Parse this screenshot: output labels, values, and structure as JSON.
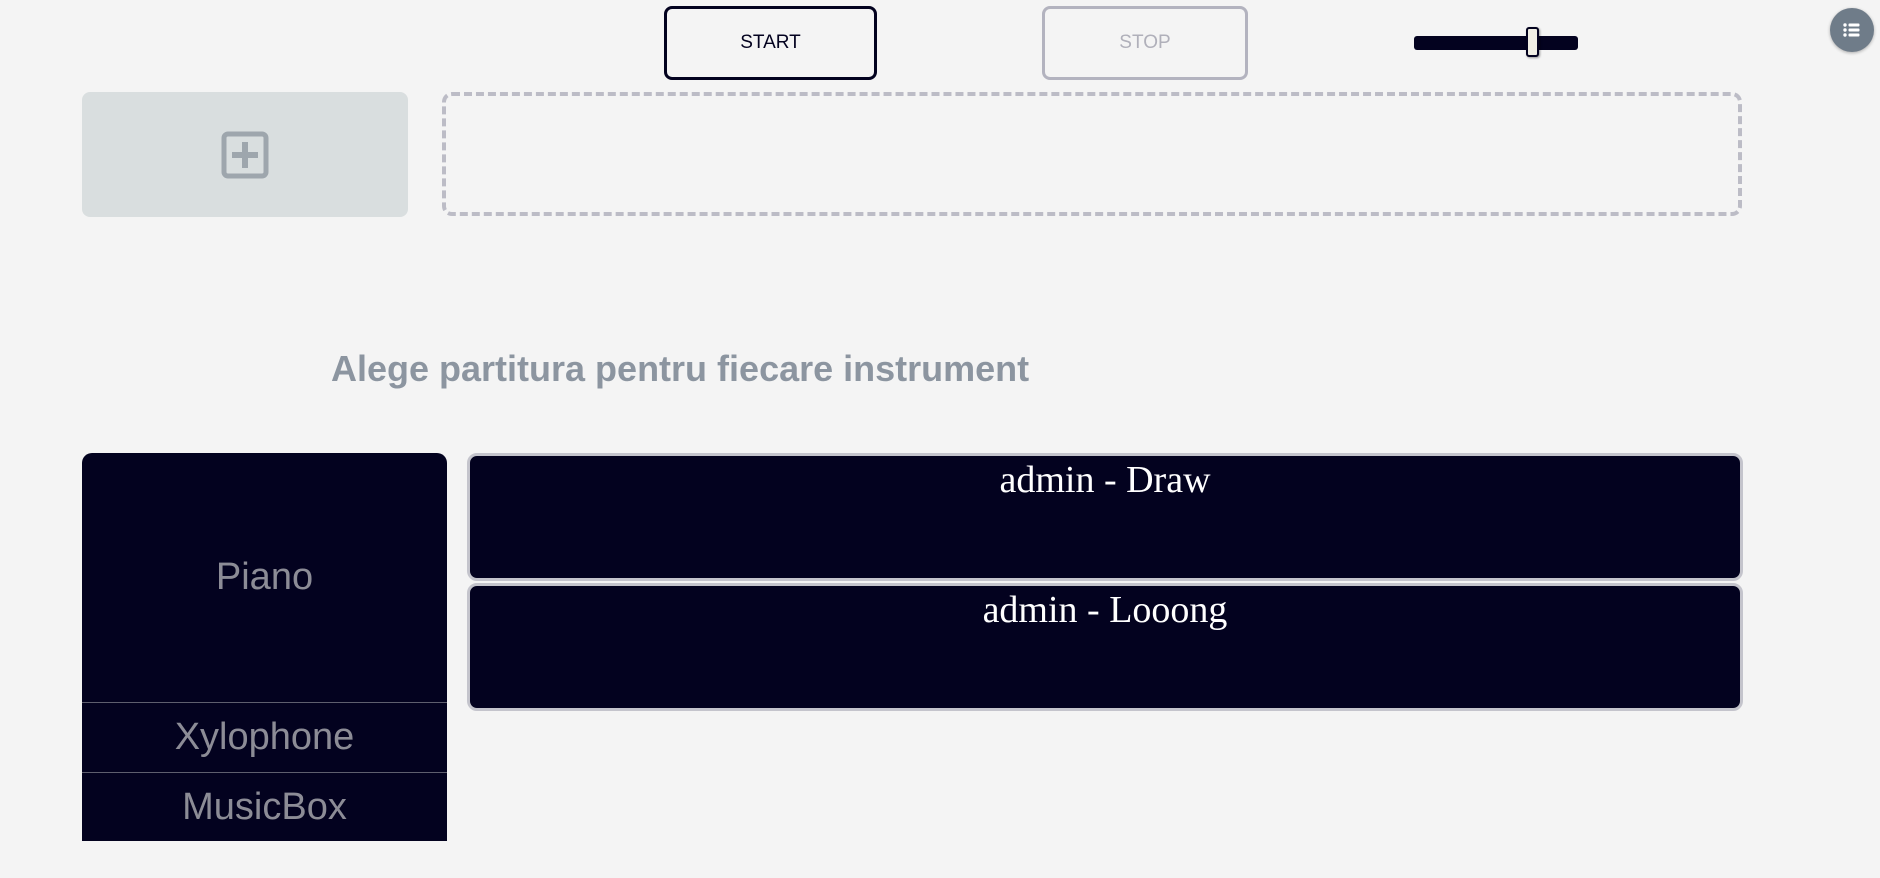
{
  "controls": {
    "start_label": "START",
    "stop_label": "STOP",
    "volume_level": 0.72
  },
  "icons": {
    "menu": "list-icon",
    "add": "plus-square-icon"
  },
  "heading": "Alege partitura pentru fiecare instrument",
  "instruments": [
    {
      "label": "Piano"
    },
    {
      "label": "Xylophone"
    },
    {
      "label": "MusicBox"
    }
  ],
  "scores": [
    {
      "label": "admin - Draw"
    },
    {
      "label": "admin - Looong"
    }
  ],
  "colors": {
    "background": "#f4f4f4",
    "dark": "#03021f",
    "muted_text": "#8c95a0",
    "add_box": "#d9dedf",
    "menu_button": "#6f7c89"
  }
}
